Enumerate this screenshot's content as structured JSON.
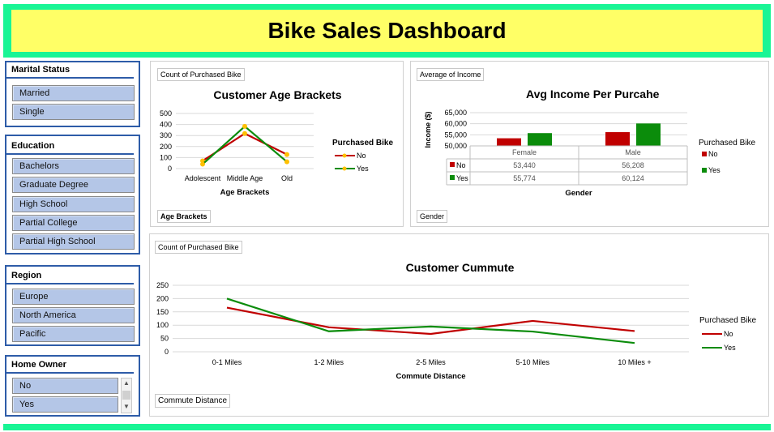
{
  "title": "Bike Sales Dashboard",
  "slicers": {
    "marital_status": {
      "title": "Marital Status",
      "items": [
        "Married",
        "Single"
      ]
    },
    "education": {
      "title": "Education",
      "items": [
        "Bachelors",
        "Graduate Degree",
        "High School",
        "Partial College",
        "Partial High School"
      ]
    },
    "region": {
      "title": "Region",
      "items": [
        "Europe",
        "North America",
        "Pacific"
      ]
    },
    "home_owner": {
      "title": "Home Owner",
      "items": [
        "No",
        "Yes"
      ]
    }
  },
  "panels": {
    "age": {
      "value_field": "Count of Purchased Bike",
      "axis_field": "Age Brackets"
    },
    "income": {
      "value_field": "Average of Income",
      "axis_field": "Gender"
    },
    "commute": {
      "value_field": "Count of Purchased Bike",
      "axis_field": "Commute Distance"
    }
  },
  "colors": {
    "no": "#c00000",
    "yes": "#0b8c0b",
    "marker": "#ffc000",
    "banner": "#19f595",
    "banner_inner": "#ffff66",
    "slicer_border": "#2e5ca8",
    "slicer_item": "#b4c6e7"
  },
  "chart_data": [
    {
      "id": "age",
      "type": "line",
      "title": "Customer Age Brackets",
      "xlabel": "Age Brackets",
      "ylabel": "",
      "categories": [
        "Adolescent",
        "Middle Age",
        "Old"
      ],
      "ylim": [
        0,
        500
      ],
      "yticks": [
        "500",
        "400",
        "300",
        "200",
        "100",
        "0"
      ],
      "legend_title": "Purchased Bike",
      "legend_position": "right",
      "markers": true,
      "grid": true,
      "series": [
        {
          "name": "No",
          "values": [
            70,
            318,
            128
          ]
        },
        {
          "name": "Yes",
          "values": [
            40,
            383,
            62
          ]
        }
      ]
    },
    {
      "id": "income",
      "type": "bar",
      "title": "Avg Income Per Purcahe",
      "xlabel": "Gender",
      "ylabel": "Income ($)",
      "categories": [
        "Female",
        "Male"
      ],
      "ylim": [
        50000,
        65000
      ],
      "yticks": [
        "65,000",
        "60,000",
        "55,000",
        "50,000"
      ],
      "legend_title": "Purchased Bike",
      "legend_position": "right",
      "grid": true,
      "data_table": true,
      "series": [
        {
          "name": "No",
          "values": [
            53440,
            56208
          ],
          "labels": [
            "53,440",
            "56,208"
          ]
        },
        {
          "name": "Yes",
          "values": [
            55774,
            60124
          ],
          "labels": [
            "55,774",
            "60,124"
          ]
        }
      ]
    },
    {
      "id": "commute",
      "type": "line",
      "title": "Customer Cummute",
      "xlabel": "Commute Distance",
      "ylabel": "",
      "categories": [
        "0-1 Miles",
        "1-2 Miles",
        "2-5 Miles",
        "5-10 Miles",
        "10 Miles +"
      ],
      "ylim": [
        0,
        250
      ],
      "yticks": [
        "250",
        "200",
        "150",
        "100",
        "50",
        "0"
      ],
      "legend_title": "Purchased Bike",
      "legend_position": "right",
      "grid": true,
      "series": [
        {
          "name": "No",
          "values": [
            166,
            92,
            67,
            116,
            78
          ]
        },
        {
          "name": "Yes",
          "values": [
            200,
            77,
            95,
            76,
            33
          ]
        }
      ]
    }
  ]
}
